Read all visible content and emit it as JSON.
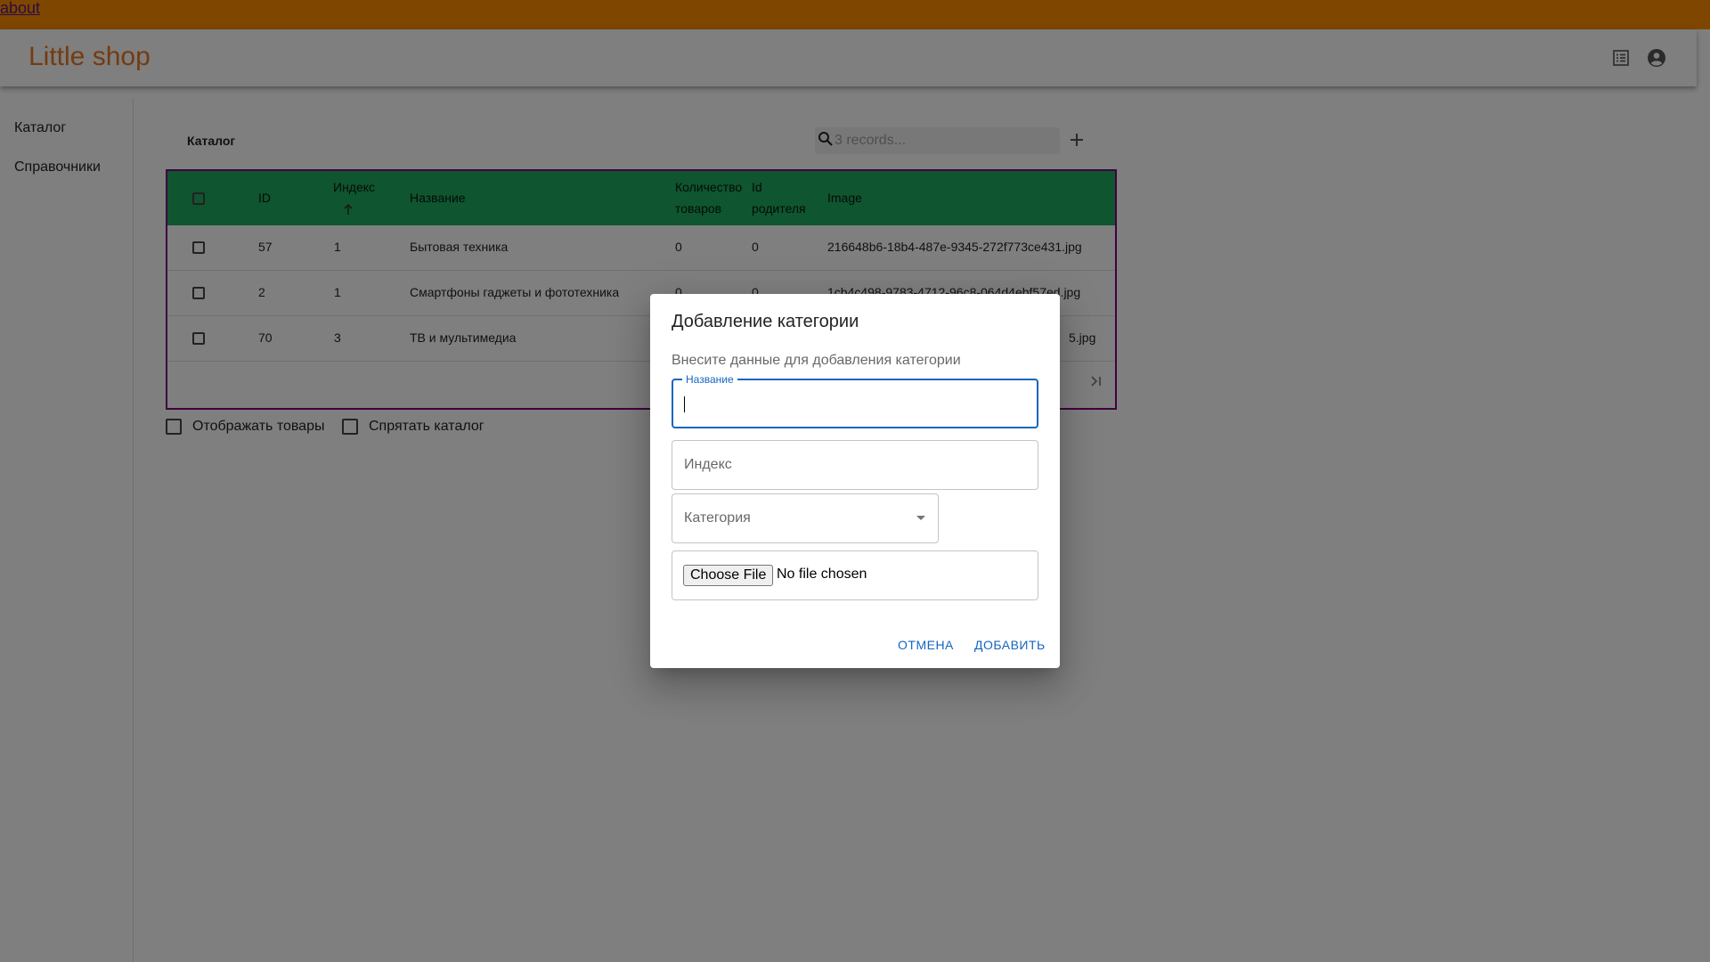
{
  "topbar": {
    "link": "about"
  },
  "appbar": {
    "title": "Little shop",
    "icons": [
      "list-alt-icon",
      "account-circle-icon"
    ]
  },
  "sidebar": {
    "items": [
      {
        "label": "Каталог"
      },
      {
        "label": "Справочники"
      }
    ]
  },
  "catalog": {
    "title": "Каталог",
    "search_placeholder": "3 records...",
    "columns": {
      "id": "ID",
      "index": "Индекс",
      "name": "Название",
      "count_line1": "Количество",
      "count_line2": "товаров",
      "parent_line1": "Id",
      "parent_line2": "родителя",
      "image": "Image"
    },
    "rows": [
      {
        "id": "57",
        "index": "1",
        "name": "Бытовая техника",
        "count": "0",
        "parent": "0",
        "image": "216648b6-18b4-487e-9345-272f773ce431.jpg"
      },
      {
        "id": "2",
        "index": "1",
        "name": "Смартфоны гаджеты и фототехника",
        "count": "0",
        "parent": "0",
        "image": "1cb4c498-9783-4712-96c8-064d4ebf57ed.jpg"
      },
      {
        "id": "70",
        "index": "3",
        "name": "ТВ и мультимедиа",
        "count": "",
        "parent": "",
        "image": "5.jpg"
      }
    ],
    "show_products_label": "Отображать товары",
    "hide_catalog_label": "Спрятать каталог"
  },
  "dialog": {
    "title": "Добавление категории",
    "text": "Внесите данные для добавления категории",
    "name_label": "Название",
    "index_placeholder": "Индекс",
    "category_placeholder": "Категория",
    "file_button": "Choose File",
    "file_status": "No file chosen",
    "cancel": "ОТМЕНА",
    "add": "ДОБАВИТЬ"
  },
  "colors": {
    "topbar": "#ff8c00",
    "table_header": "#1fab5e",
    "table_border": "#800080",
    "primary": "#1565c0",
    "title": "#e87722"
  }
}
